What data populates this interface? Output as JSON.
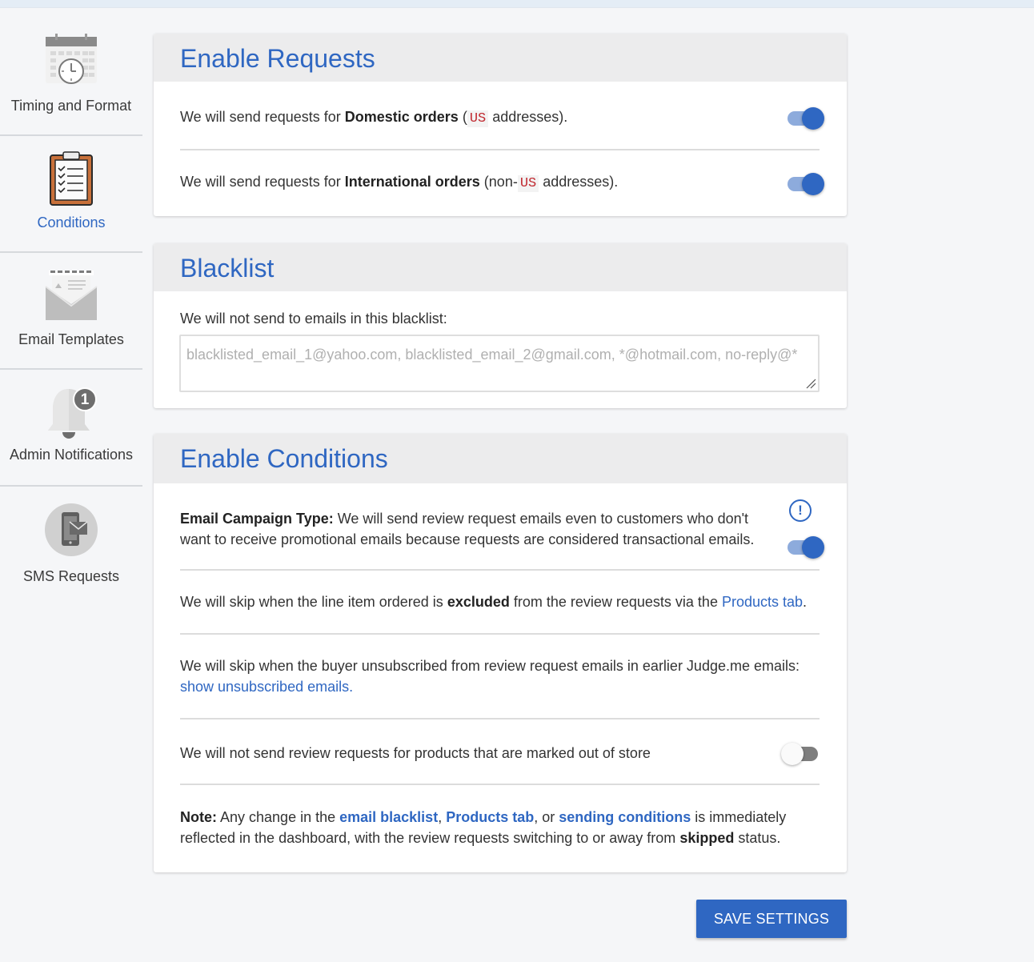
{
  "sidebar": {
    "items": [
      {
        "label": "Timing and Format",
        "icon": "calendar-clock-icon",
        "active": false
      },
      {
        "label": "Conditions",
        "icon": "clipboard-checklist-icon",
        "active": true
      },
      {
        "label": "Email Templates",
        "icon": "open-envelope-icon",
        "active": false
      },
      {
        "label": "Admin Notifications",
        "icon": "bell-icon",
        "badge": "1",
        "active": false
      },
      {
        "label": "SMS Requests",
        "icon": "phone-mail-icon",
        "active": false
      }
    ]
  },
  "enable_requests": {
    "title": "Enable Requests",
    "domestic": {
      "prefix": "We will send requests for ",
      "bold": "Domestic orders",
      "open": " (",
      "code": "US",
      "suffix": " addresses).",
      "enabled": true
    },
    "international": {
      "prefix": "We will send requests for ",
      "bold": "International orders",
      "open": " (non-",
      "code": "US",
      "suffix": " addresses).",
      "enabled": true
    }
  },
  "blacklist": {
    "title": "Blacklist",
    "description": "We will not send to emails in this blacklist:",
    "placeholder": "blacklisted_email_1@yahoo.com, blacklisted_email_2@gmail.com,  *@hotmail.com, no-reply@*"
  },
  "enable_conditions": {
    "title": "Enable Conditions",
    "campaign": {
      "bold": "Email Campaign Type:",
      "text": " We will send review request emails even to customers who don't want to receive promotional emails because requests are considered transactional emails.",
      "info_icon": "!",
      "enabled": true
    },
    "excluded": {
      "prefix": "We will skip when the line item ordered is ",
      "bold": "excluded",
      "middle": " from the review requests via the ",
      "link": "Products tab",
      "suffix": "."
    },
    "unsubscribed": {
      "text": "We will skip when the buyer unsubscribed from review request emails in earlier Judge.me emails: ",
      "link": "show unsubscribed emails."
    },
    "out_of_store": {
      "text": "We will not send review requests for products that are marked out of store",
      "enabled": false
    },
    "note": {
      "bold": "Note:",
      "t1": " Any change in the ",
      "link1": "email blacklist",
      "t2": ", ",
      "link2": "Products tab",
      "t3": ", or ",
      "link3": "sending conditions",
      "t4": " is immediately reflected in the dashboard, with the review requests switching to or away from ",
      "bold2": "skipped",
      "t5": " status."
    }
  },
  "save_button": "SAVE SETTINGS",
  "colors": {
    "accent": "#2f67c2",
    "code": "#c0282f",
    "toggle_track_on": "#8dabdc"
  }
}
